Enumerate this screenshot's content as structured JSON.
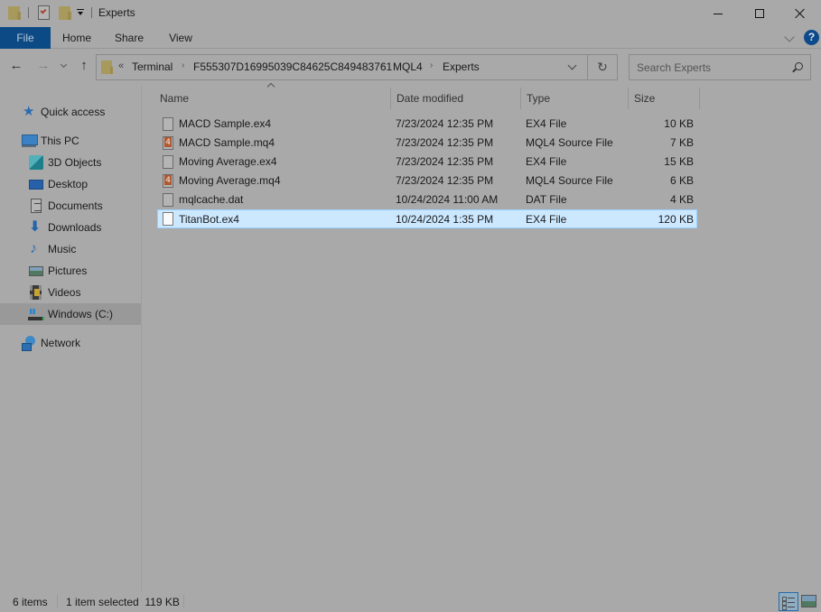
{
  "window": {
    "title": "Experts",
    "controls": {
      "minimize": "minimize",
      "maximize": "maximize",
      "close": "close"
    }
  },
  "quick_access_toolbar": {
    "icons": [
      "folder-icon",
      "properties-icon",
      "new-folder-icon",
      "customize-dropdown-icon"
    ]
  },
  "ribbon": {
    "tabs": [
      {
        "label": "File",
        "active": true
      },
      {
        "label": "Home"
      },
      {
        "label": "Share"
      },
      {
        "label": "View"
      }
    ],
    "help_label": "?"
  },
  "navigation": {
    "back": "←",
    "forward": "→",
    "up": "↑",
    "more_crumbs": "«",
    "breadcrumbs": [
      "Terminal",
      "F555307D16995039C84625C849483761",
      "MQL4",
      "Experts"
    ],
    "crumb_separator": "›",
    "refresh": "↻",
    "search_placeholder": "Search Experts"
  },
  "sidebar": {
    "items": [
      {
        "label": "Quick access",
        "icon": "quick-access-star-icon"
      },
      {
        "label": "This PC",
        "icon": "this-pc-icon"
      },
      {
        "label": "3D Objects",
        "icon": "3d-objects-icon"
      },
      {
        "label": "Desktop",
        "icon": "desktop-icon"
      },
      {
        "label": "Documents",
        "icon": "documents-icon"
      },
      {
        "label": "Downloads",
        "icon": "downloads-icon"
      },
      {
        "label": "Music",
        "icon": "music-icon"
      },
      {
        "label": "Pictures",
        "icon": "pictures-icon"
      },
      {
        "label": "Videos",
        "icon": "videos-icon"
      },
      {
        "label": "Windows (C:)",
        "icon": "drive-icon",
        "selected": true
      },
      {
        "label": "Network",
        "icon": "network-icon"
      }
    ],
    "glyphs": {
      "star": "★",
      "down": "⬇",
      "music": "♪"
    }
  },
  "file_list": {
    "columns": [
      "Name",
      "Date modified",
      "Type",
      "Size"
    ],
    "sorted_by": "Name",
    "rows": [
      {
        "name": "MACD Sample.ex4",
        "date": "7/23/2024 12:35 PM",
        "type": "EX4 File",
        "size": "10 KB",
        "icon": "ex4"
      },
      {
        "name": "MACD Sample.mq4",
        "date": "7/23/2024 12:35 PM",
        "type": "MQL4 Source File",
        "size": "7 KB",
        "icon": "mq4"
      },
      {
        "name": "Moving Average.ex4",
        "date": "7/23/2024 12:35 PM",
        "type": "EX4 File",
        "size": "15 KB",
        "icon": "ex4"
      },
      {
        "name": "Moving Average.mq4",
        "date": "7/23/2024 12:35 PM",
        "type": "MQL4 Source File",
        "size": "6 KB",
        "icon": "mq4"
      },
      {
        "name": "mqlcache.dat",
        "date": "10/24/2024 11:00 AM",
        "type": "DAT File",
        "size": "4 KB",
        "icon": "dat"
      },
      {
        "name": "TitanBot.ex4",
        "date": "10/24/2024 1:35 PM",
        "type": "EX4 File",
        "size": "120 KB",
        "icon": "ex4",
        "selected": true
      }
    ]
  },
  "status_bar": {
    "item_count": "6 items",
    "selection": "1 item selected  119 KB",
    "views": [
      "details",
      "large-icons"
    ],
    "active_view": "details"
  },
  "colors": {
    "file_tab": "#0b4a85",
    "selection_bg": "#cce8ff",
    "selection_border": "#99d1ff",
    "overlay_bg": "#a9a9a9"
  }
}
